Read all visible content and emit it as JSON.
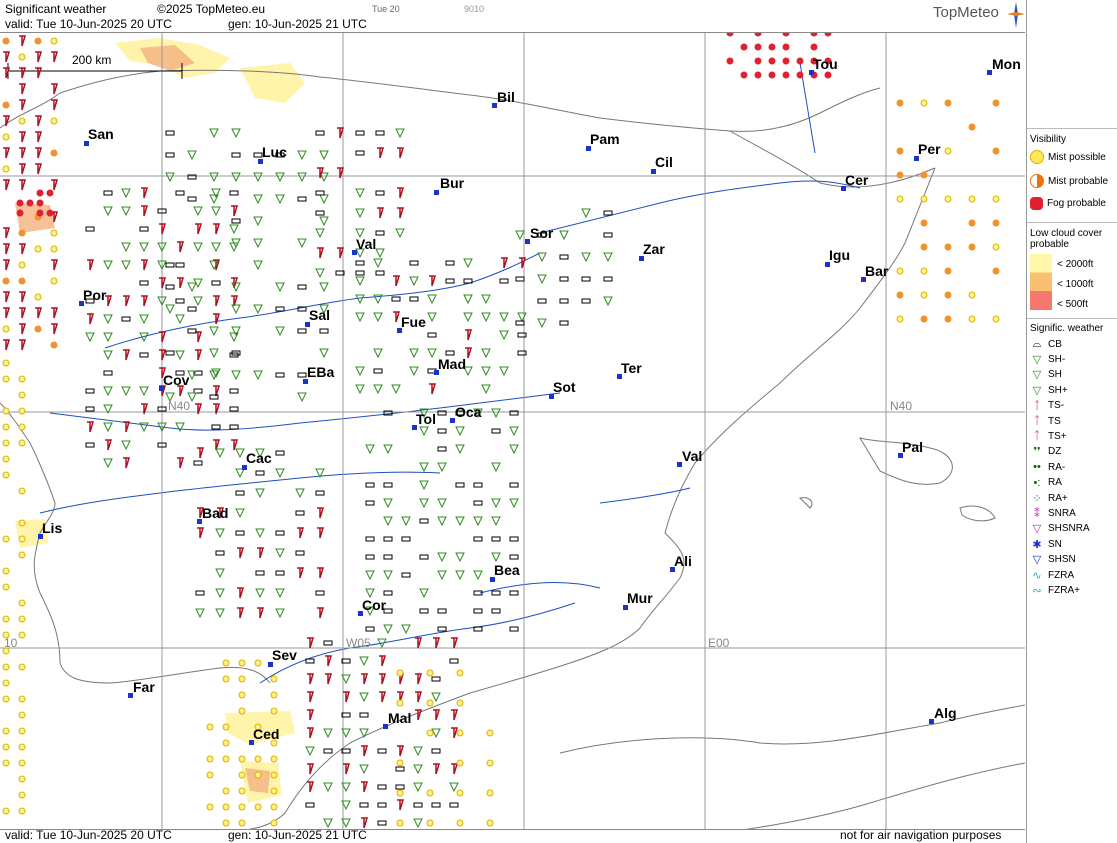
{
  "header": {
    "title": "Significant weather",
    "copyright": "©2025 TopMeteo.eu",
    "small1": "Tue 20",
    "small2": "9010",
    "valid": "valid:  Tue  10-Jun-2025  20 UTC",
    "gen": "gen: 10-Jun-2025 21 UTC",
    "logo": "TopMeteo"
  },
  "scale_label": "200 km",
  "grid_labels": {
    "n40_left": "N40",
    "n40_right": "N40",
    "w05": "W05",
    "e00": "E00",
    "w10": "10"
  },
  "cities": [
    {
      "name": "Bil"
    },
    {
      "name": "Tou"
    },
    {
      "name": "Mon"
    },
    {
      "name": "San"
    },
    {
      "name": "Pam"
    },
    {
      "name": "Luc"
    },
    {
      "name": "Cil"
    },
    {
      "name": "Per"
    },
    {
      "name": "Bur"
    },
    {
      "name": "Cer"
    },
    {
      "name": "Sor"
    },
    {
      "name": "Val"
    },
    {
      "name": "Zar"
    },
    {
      "name": "Igu"
    },
    {
      "name": "Bar"
    },
    {
      "name": "Por"
    },
    {
      "name": "Sal"
    },
    {
      "name": "Fue"
    },
    {
      "name": "Mad"
    },
    {
      "name": "EBa"
    },
    {
      "name": "Ter"
    },
    {
      "name": "Cov"
    },
    {
      "name": "Sot"
    },
    {
      "name": "Tol"
    },
    {
      "name": "Oca"
    },
    {
      "name": "Pal"
    },
    {
      "name": "Cac"
    },
    {
      "name": "Val"
    },
    {
      "name": "Bad"
    },
    {
      "name": "Lis"
    },
    {
      "name": "Ali"
    },
    {
      "name": "Bea"
    },
    {
      "name": "Mur"
    },
    {
      "name": "Cor"
    },
    {
      "name": "Sev"
    },
    {
      "name": "Far"
    },
    {
      "name": "Alg"
    },
    {
      "name": "Mal"
    },
    {
      "name": "Ced"
    }
  ],
  "footer": {
    "valid": "valid:  Tue  10-Jun-2025  20 UTC",
    "gen": "gen: 10-Jun-2025 21 UTC",
    "note": "not for air navigation purposes"
  },
  "legend": {
    "visibility_title": "Visibility",
    "vis": [
      "Mist possible",
      "Mist probable",
      "Fog probable"
    ],
    "lowcloud_title": "Low cloud cover probable",
    "lowcloud": [
      "< 2000ft",
      "< 1000ft",
      "<   500ft"
    ],
    "sigwx_title": "Signific. weather",
    "sigwx": [
      "CB",
      "SH-",
      "SH",
      "SH+",
      "TS-",
      "TS",
      "TS+",
      "DZ",
      "RA-",
      "RA",
      "RA+",
      "SNRA",
      "SHSNRA",
      "SN",
      "SHSN",
      "FZRA",
      "FZRA+"
    ]
  },
  "colors": {
    "city_dot": "#1b33c7",
    "thunder": "#b01020",
    "shower": "#2e8b1e",
    "mist": "#ffd400",
    "fog": "#e02030",
    "lowcloud": "#fff3a0"
  }
}
